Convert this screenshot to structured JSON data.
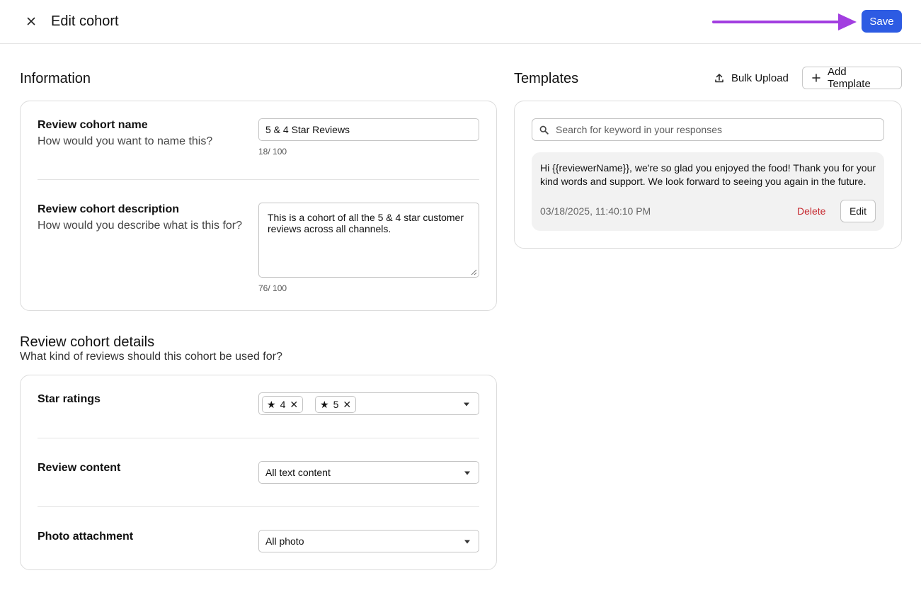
{
  "header": {
    "title": "Edit cohort",
    "save_label": "Save",
    "arrow_color": "#a23ee0",
    "save_color": "#2d5be3"
  },
  "information": {
    "heading": "Information",
    "name_field": {
      "label": "Review cohort name",
      "help": "How would you want to name this?",
      "value": "5 & 4 Star Reviews",
      "counter": "18/ 100"
    },
    "description_field": {
      "label": "Review cohort description",
      "help": "How would you describe what is this for?",
      "value": "This is a cohort of all the 5 & 4 star customer reviews across all channels.",
      "counter": "76/ 100"
    }
  },
  "details": {
    "heading": "Review cohort details",
    "subheading": "What kind of reviews should this cohort be used for?",
    "star_ratings": {
      "label": "Star ratings",
      "chips": [
        "4",
        "5"
      ]
    },
    "review_content": {
      "label": "Review content",
      "selected": "All text content"
    },
    "photo_attachment": {
      "label": "Photo attachment",
      "selected": "All photo"
    }
  },
  "templates": {
    "heading": "Templates",
    "bulk_upload_label": "Bulk Upload",
    "add_template_label": "Add Template",
    "search_placeholder": "Search for keyword in your responses",
    "items": [
      {
        "text": "Hi {{reviewerName}}, we're so glad you enjoyed the food! Thank you for your kind words and support. We look forward to seeing you again in the future.",
        "date": "03/18/2025, 11:40:10 PM",
        "delete_label": "Delete",
        "edit_label": "Edit"
      }
    ]
  }
}
